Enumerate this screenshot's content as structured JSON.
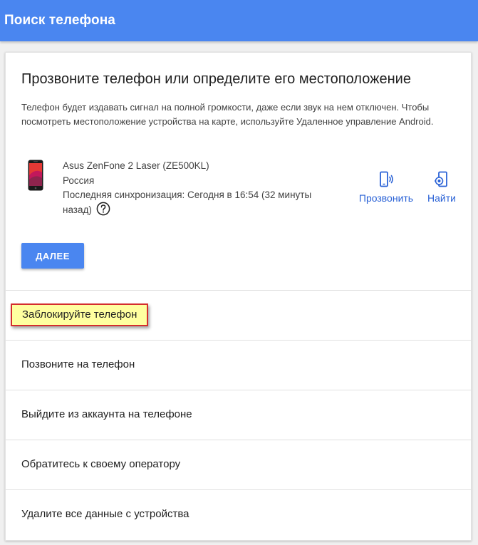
{
  "header": {
    "title": "Поиск телефона"
  },
  "card": {
    "title": "Прозвоните телефон или определите его местоположение",
    "description": "Телефон будет издавать сигнал на полной громкости, даже если звук на нем отключен. Чтобы посмотреть местоположение устройства на карте, используйте Удаленное управление Android.",
    "device": {
      "name": "Asus ZenFone 2 Laser (ZE500KL)",
      "country": "Россия",
      "last_sync": "Последняя синхронизация: Сегодня в 16:54 (32 минуты назад)"
    },
    "actions": {
      "ring_label": "Прозвонить",
      "find_label": "Найти"
    },
    "next_label": "ДАЛЕЕ"
  },
  "options": [
    {
      "label": "Заблокируйте телефон",
      "highlighted": true
    },
    {
      "label": "Позвоните на телефон"
    },
    {
      "label": "Выйдите из аккаунта на телефоне"
    },
    {
      "label": "Обратитесь к своему оператору"
    },
    {
      "label": "Удалите все данные с устройства"
    }
  ],
  "colors": {
    "header_bg": "#4a86f0",
    "accent": "#2a62d6",
    "highlight_bg": "#ffffa0",
    "highlight_border": "#d42d2d"
  },
  "icons": {
    "ring": "phone-ring-icon",
    "find": "phone-locate-icon",
    "help": "help-circle-icon",
    "device": "device-photo"
  }
}
